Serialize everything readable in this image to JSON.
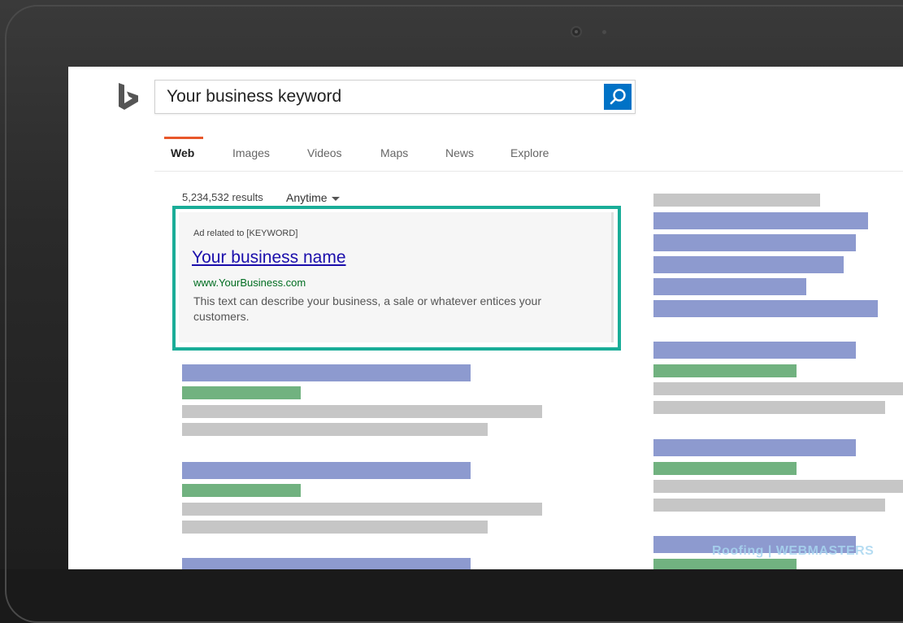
{
  "search": {
    "query": "Your business keyword"
  },
  "nav": {
    "tabs": [
      {
        "label": "Web",
        "active": true
      },
      {
        "label": "Images"
      },
      {
        "label": "Videos"
      },
      {
        "label": "Maps"
      },
      {
        "label": "News"
      },
      {
        "label": "Explore"
      }
    ]
  },
  "results": {
    "count": "5,234,532 results",
    "time_filter": "Anytime"
  },
  "ad": {
    "label": "Ad related to [KEYWORD]",
    "title": "Your business name",
    "url": "www.YourBusiness.com",
    "description": "This text can describe your business, a sale or whatever entices your customers."
  },
  "watermark": "Roofing | WEBMASTERS",
  "colors": {
    "ad_border": "#1aad98",
    "tab_accent": "#e8572a",
    "search_button": "#0072c6",
    "link": "#1a0dab",
    "url": "#006d21",
    "placeholder_title": "#8d9acf",
    "placeholder_url": "#71b280",
    "placeholder_text": "#c6c6c6"
  }
}
